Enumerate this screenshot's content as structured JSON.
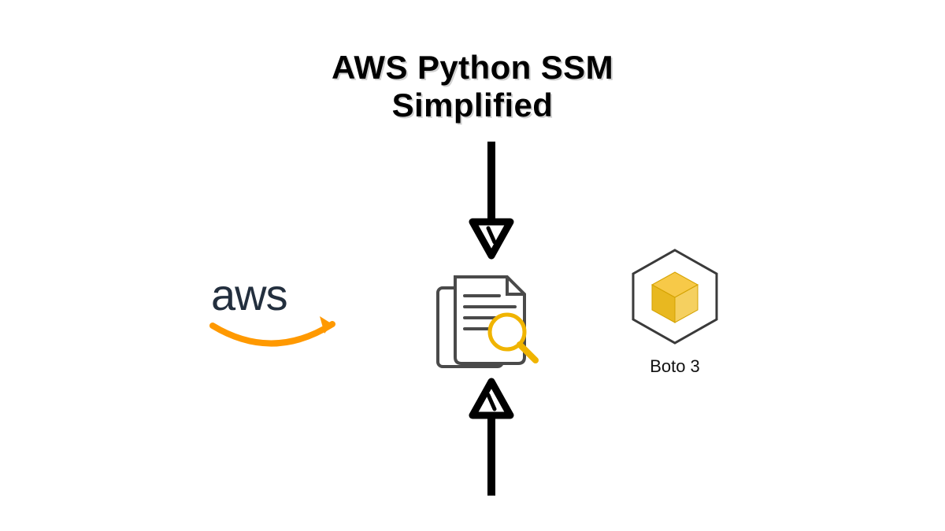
{
  "title_line1": "AWS Python SSM",
  "title_line2": "Simplified",
  "aws_label": "aws",
  "boto3_label": "Boto 3",
  "colors": {
    "aws_orange": "#FF9900",
    "aws_dark": "#232F3E",
    "accent_yellow": "#F7C948",
    "icon_gray": "#4A4A4A"
  }
}
